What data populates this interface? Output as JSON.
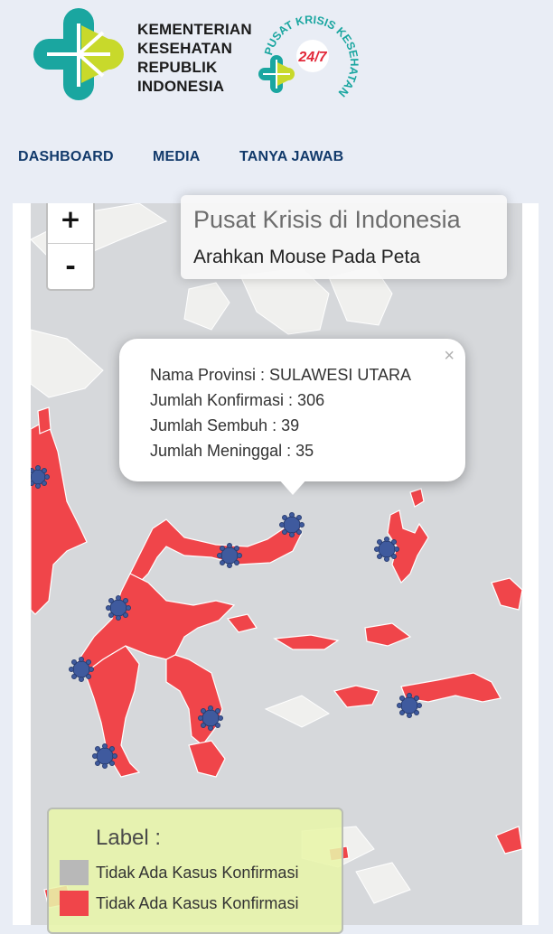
{
  "header": {
    "ministry_lines": [
      "KEMENTERIAN",
      "KESEHATAN",
      "REPUBLIK",
      "INDONESIA"
    ],
    "crisis_logo": {
      "arc_text": "PUSAT KRISIS KESEHATAN",
      "badge": "24/7"
    },
    "logo_icon": "kemenkes-clover-logo"
  },
  "nav": {
    "items": [
      {
        "label": "DASHBOARD"
      },
      {
        "label": "MEDIA"
      },
      {
        "label": "TANYA JAWAB"
      }
    ]
  },
  "map": {
    "zoom_in_label": "+",
    "zoom_out_label": "-",
    "info_title": "Pusat Krisis di Indonesia",
    "info_hint": "Arahkan Mouse Pada Peta",
    "popup": {
      "close_label": "×",
      "province_label": "Nama Provinsi : SULAWESI UTARA",
      "confirmed_label": "Jumlah Konfirmasi : 306",
      "recovered_label": "Jumlah Sembuh : 39",
      "deaths_label": "Jumlah Meninggal : 35",
      "province": "SULAWESI UTARA",
      "confirmed": 306,
      "recovered": 39,
      "deaths": 35
    },
    "marker_icon": "virus-icon",
    "colors": {
      "region_fill": "#f0454a",
      "sea": "#d6d8db",
      "land_other": "#f0f0ee",
      "legend_bg": "#e8f5aa"
    },
    "legend": {
      "title": "Label :",
      "items": [
        {
          "label": "Tidak Ada Kasus Konfirmasi",
          "swatch_color": "#b8b8b8"
        },
        {
          "label": "Tidak Ada Kasus Konfirmasi",
          "swatch_color": "#f0454a"
        }
      ]
    }
  },
  "brand_colors": {
    "teal": "#1aa6a0",
    "lime": "#c8d92b",
    "nav_text": "#123a6b"
  }
}
